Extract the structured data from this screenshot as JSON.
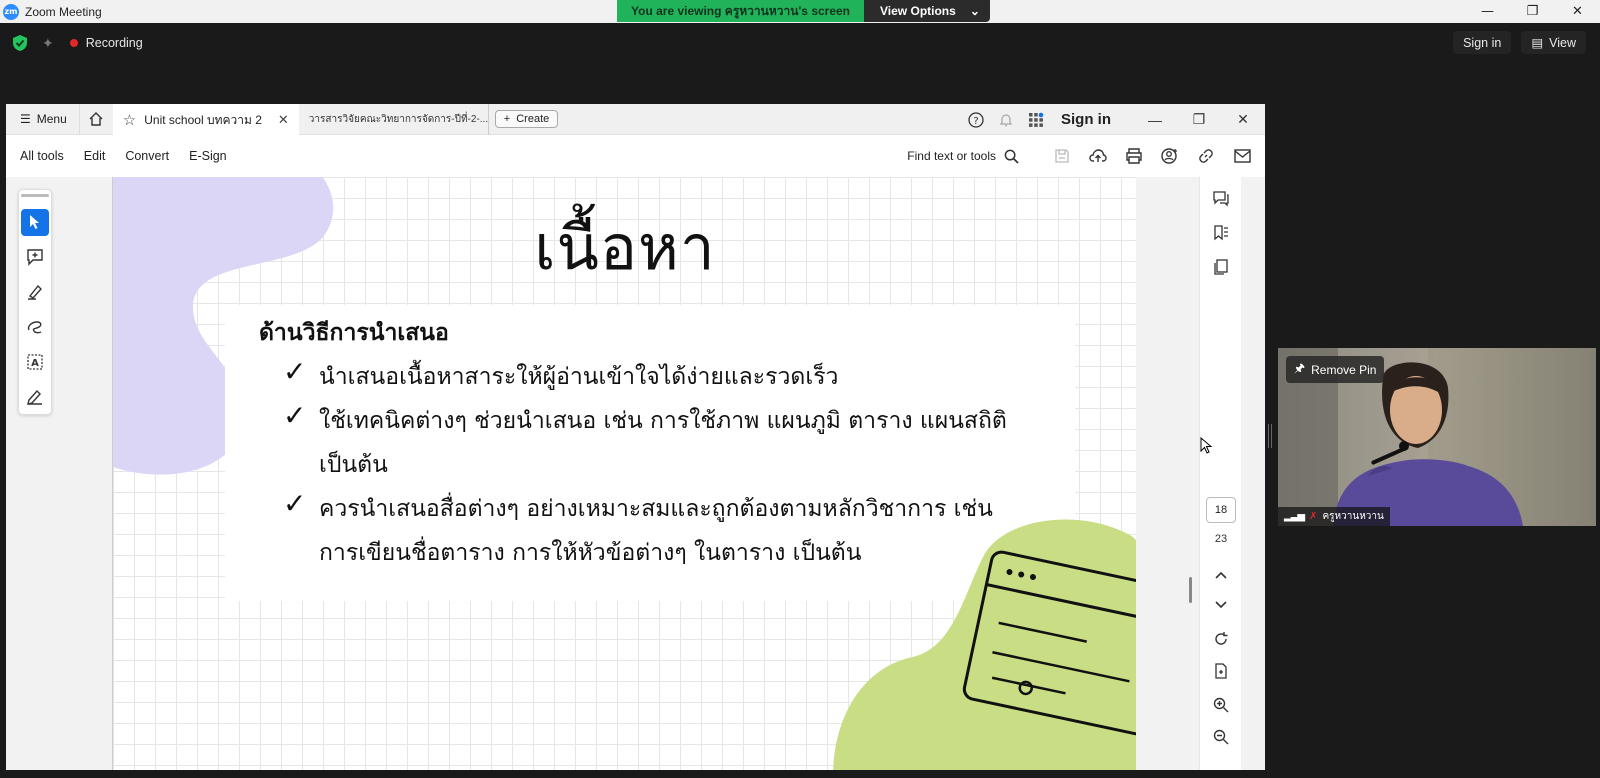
{
  "zoom": {
    "app_title": "Zoom Meeting",
    "logo_text": "zm",
    "viewing_banner": "You are viewing ครูหวานหวาน's screen",
    "view_options": "View Options",
    "recording_label": "Recording",
    "sign_in": "Sign in",
    "view_label": "View"
  },
  "acrobat": {
    "menu_label": "Menu",
    "active_tab": "Unit school บทความ 2",
    "inactive_tab": "วารสารวิจัยคณะวิทยาการจัดการ-ปีที่-2-...",
    "create_label": "Create",
    "sign_in": "Sign in",
    "toolbar": [
      "All tools",
      "Edit",
      "Convert",
      "E-Sign"
    ],
    "find_placeholder": "Find text or tools",
    "current_page": "18",
    "total_pages": "23"
  },
  "slide": {
    "title": "เนื้อหา",
    "heading": "ด้านวิธีการนำเสนอ",
    "bullets": [
      {
        "lines": [
          "นำเสนอเนื้อหาสาระให้ผู้อ่านเข้าใจได้ง่ายและรวดเร็ว"
        ]
      },
      {
        "lines": [
          "ใช้เทคนิคต่างๆ ช่วยนำเสนอ เช่น การใช้ภาพ แผนภูมิ ตาราง แผนสถิติ",
          "เป็นต้น"
        ]
      },
      {
        "lines": [
          "ควรนำเสนอสื่อต่างๆ อย่างเหมาะสมและถูกต้องตามหลักวิชาการ เช่น",
          "การเขียนชื่อตาราง การให้หัวข้อต่างๆ ในตาราง เป็นต้น"
        ]
      }
    ]
  },
  "video": {
    "remove_pin": "Remove Pin",
    "participant_name": "ครูหวานหวาน"
  },
  "colors": {
    "accent_blue": "#1473e6",
    "banner_green": "#21b35a",
    "blob_purple": "#d9d3f5",
    "blob_green": "#c9dd85",
    "record_red": "#e02828"
  }
}
